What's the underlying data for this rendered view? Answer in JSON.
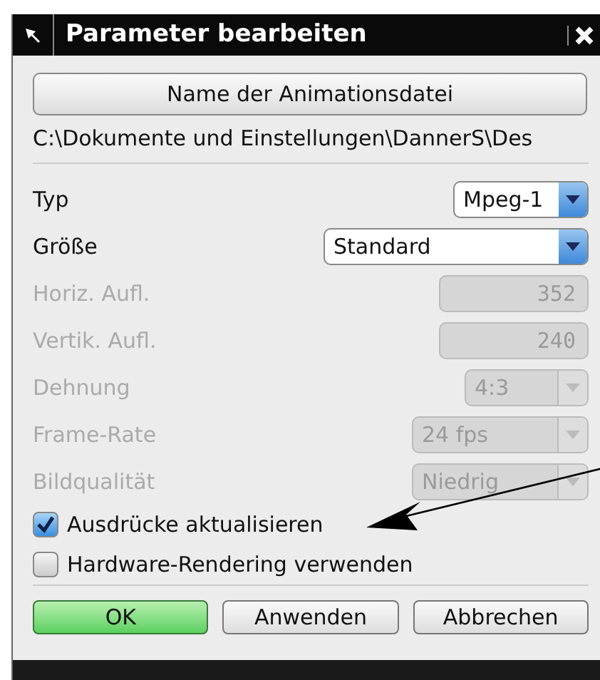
{
  "window": {
    "title": "Parameter bearbeiten"
  },
  "file_button": "Name der Animationsdatei",
  "path": "C:\\Dokumente und Einstellungen\\DannerS\\Des",
  "fields": [
    {
      "kind": "select",
      "label": "Typ",
      "value": "Mpeg-1",
      "disabled": false
    },
    {
      "kind": "select",
      "label": "Größe",
      "value": "Standard",
      "disabled": false
    },
    {
      "kind": "number",
      "label": "Horiz. Aufl.",
      "value": "352",
      "disabled": true
    },
    {
      "kind": "number",
      "label": "Vertik. Aufl.",
      "value": "240",
      "disabled": true
    },
    {
      "kind": "select",
      "label": "Dehnung",
      "value": "4:3",
      "disabled": true
    },
    {
      "kind": "select",
      "label": "Frame-Rate",
      "value": "24 fps",
      "disabled": true
    },
    {
      "kind": "select",
      "label": "Bildqualität",
      "value": "Niedrig",
      "disabled": true
    }
  ],
  "checkboxes": [
    {
      "label": "Ausdrücke aktualisieren",
      "checked": true
    },
    {
      "label": "Hardware-Rendering verwenden",
      "checked": false
    }
  ],
  "buttons": [
    {
      "label": "OK",
      "default": true
    },
    {
      "label": "Anwenden",
      "default": false
    },
    {
      "label": "Abbrechen",
      "default": false
    }
  ]
}
